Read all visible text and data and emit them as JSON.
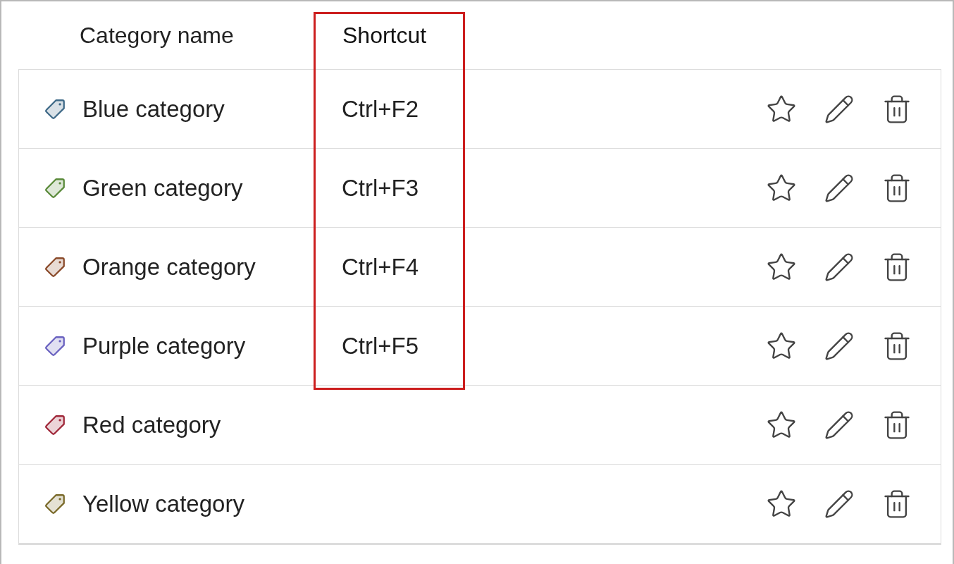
{
  "columns": [
    {
      "label": "Category name",
      "highlighted": false
    },
    {
      "label": "Shortcut",
      "highlighted": true
    }
  ],
  "categories": [
    {
      "name": "Blue category",
      "shortcut": "Ctrl+F2",
      "color": "#3f6a88"
    },
    {
      "name": "Green category",
      "shortcut": "Ctrl+F3",
      "color": "#5a8a3a"
    },
    {
      "name": "Orange category",
      "shortcut": "Ctrl+F4",
      "color": "#8a4a2a"
    },
    {
      "name": "Purple category",
      "shortcut": "Ctrl+F5",
      "color": "#6a62c0"
    },
    {
      "name": "Red category",
      "color": "#a0283a"
    },
    {
      "name": "Yellow category",
      "color": "#7a6a2a"
    }
  ]
}
